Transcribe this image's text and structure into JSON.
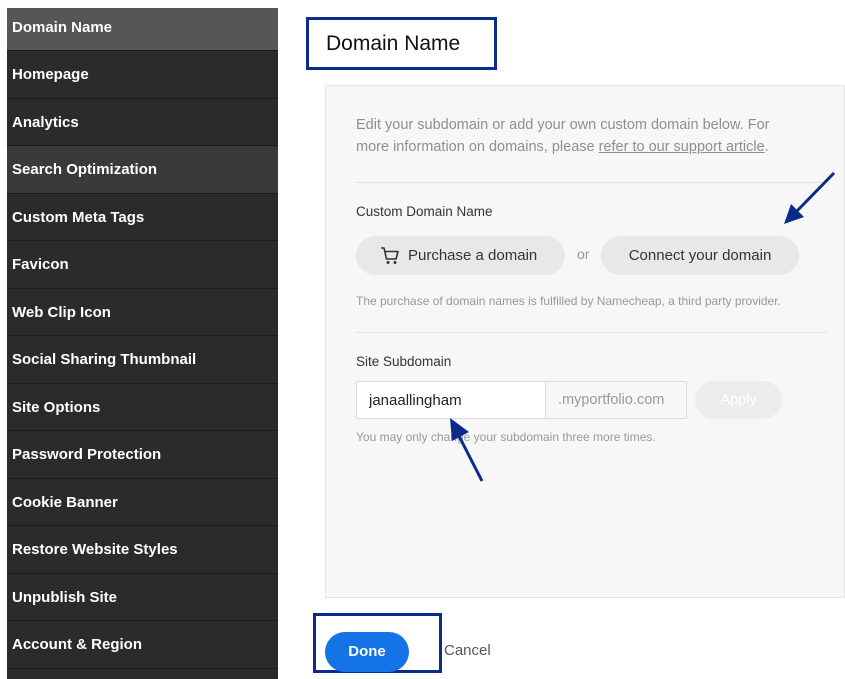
{
  "sidebar": {
    "items": [
      {
        "label": "Domain Name"
      },
      {
        "label": "Homepage"
      },
      {
        "label": "Analytics"
      },
      {
        "label": "Search Optimization"
      },
      {
        "label": "Custom Meta Tags"
      },
      {
        "label": "Favicon"
      },
      {
        "label": "Web Clip Icon"
      },
      {
        "label": "Social Sharing Thumbnail"
      },
      {
        "label": "Site Options"
      },
      {
        "label": "Password Protection"
      },
      {
        "label": "Cookie Banner"
      },
      {
        "label": "Restore Website Styles"
      },
      {
        "label": "Unpublish Site"
      },
      {
        "label": "Account & Region"
      }
    ]
  },
  "page": {
    "title": "Domain Name"
  },
  "panel": {
    "intro_text": "Edit your subdomain or add your own custom domain below. For more information on domains, please ",
    "intro_link": "refer to our support article",
    "intro_end": ".",
    "custom_domain_label": "Custom Domain Name",
    "purchase_label": "Purchase a domain",
    "or_text": "or",
    "connect_label": "Connect your domain",
    "namecheap_note": "The purchase of domain names is fulfilled by Namecheap, a third party provider.",
    "subdomain_label": "Site Subdomain",
    "subdomain_value": "janaallingham",
    "subdomain_suffix": ".myportfolio.com",
    "apply_label": "Apply",
    "change_note": "You may only change your subdomain three more times."
  },
  "footer": {
    "done_label": "Done",
    "cancel_label": "Cancel"
  },
  "colors": {
    "accent": "#1473e6",
    "annotation": "#0a2b8a",
    "sidebar_bg": "#2b2b2b"
  },
  "icons": {
    "cart": "cart-icon"
  }
}
